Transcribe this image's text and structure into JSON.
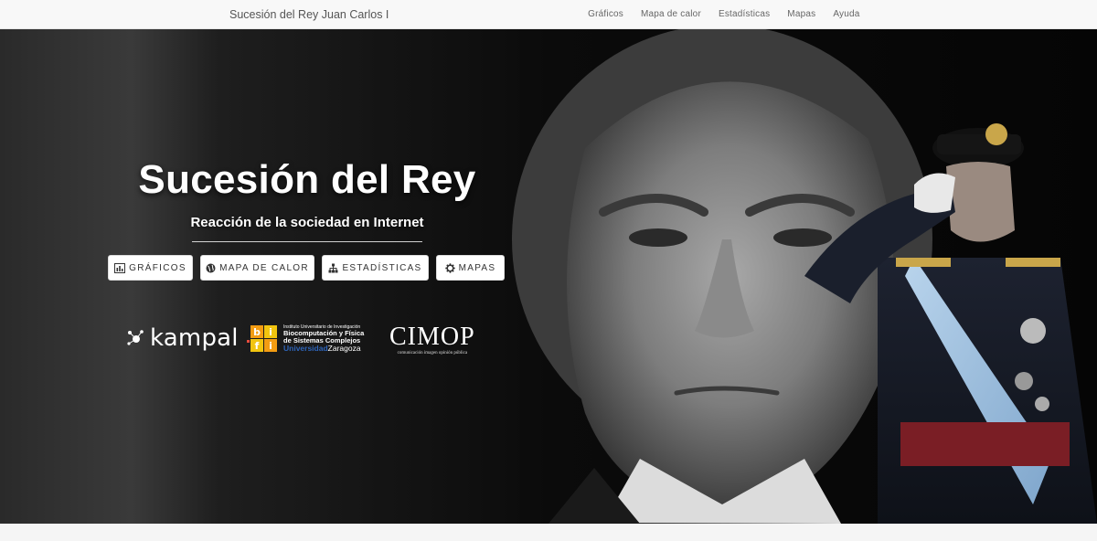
{
  "navbar": {
    "brand": "Sucesión del Rey Juan Carlos I",
    "links": [
      "Gráficos",
      "Mapa de calor",
      "Estadísticas",
      "Mapas",
      "Ayuda"
    ]
  },
  "hero": {
    "title": "Sucesión del Rey",
    "subtitle": "Reacción de la sociedad en Internet",
    "buttons": [
      {
        "label": "GRÁFICOS",
        "icon": "bar-chart-icon"
      },
      {
        "label": "MAPA DE CALOR",
        "icon": "globe-icon"
      },
      {
        "label": "ESTADÍSTICAS",
        "icon": "sitemap-icon"
      },
      {
        "label": "MAPAS",
        "icon": "gear-icon"
      }
    ],
    "logos": {
      "kampal": "kampal",
      "bifi_small": "Instituto Universitario de Investigación",
      "bifi_line1": "Biocomputación y Física",
      "bifi_line2": "de Sistemas Complejos",
      "bifi_uni_a": "Universidad",
      "bifi_uni_b": "Zaragoza",
      "cimop": "CIMOP",
      "cimop_tag": "comunicación imagen opinión pública"
    }
  },
  "colors": {
    "navbar_bg": "#f8f8f8",
    "hero_bg": "#0a0a0a",
    "button_bg": "#ffffff",
    "bifi_orange": "#f39c12",
    "bifi_blue": "#2e64b8"
  }
}
